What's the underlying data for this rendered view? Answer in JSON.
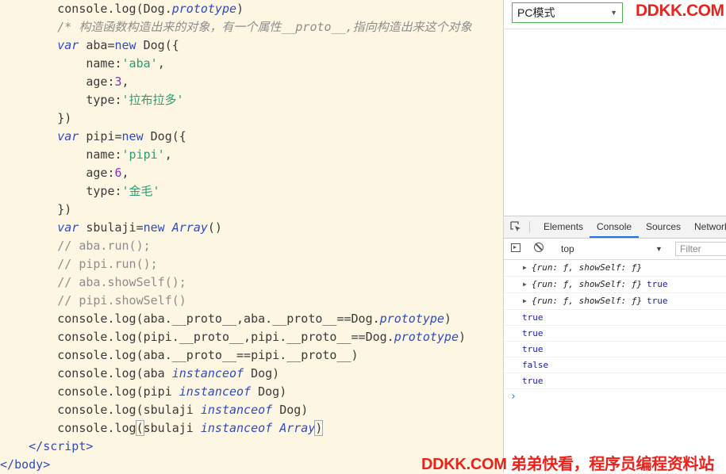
{
  "editor": {
    "lines": [
      {
        "indent": "        ",
        "tokens": [
          [
            "plain",
            "console.log(Dog."
          ],
          [
            "it",
            "prototype"
          ],
          [
            "plain",
            ")"
          ]
        ]
      },
      {
        "indent": "        ",
        "tokens": [
          [
            "cm",
            "/* 构造函数构造出来的对象，有一个属性__proto__,指向构造出来这个对象"
          ]
        ]
      },
      {
        "indent": "        ",
        "tokens": [
          [
            "it",
            "var"
          ],
          [
            "plain",
            " aba="
          ],
          [
            "kw",
            "new"
          ],
          [
            "plain",
            " Dog({"
          ]
        ]
      },
      {
        "indent": "            ",
        "tokens": [
          [
            "plain",
            "name:"
          ],
          [
            "str",
            "'aba'"
          ],
          [
            "plain",
            ","
          ]
        ]
      },
      {
        "indent": "            ",
        "tokens": [
          [
            "plain",
            "age:"
          ],
          [
            "num",
            "3"
          ],
          [
            "plain",
            ","
          ]
        ]
      },
      {
        "indent": "            ",
        "tokens": [
          [
            "plain",
            "type:"
          ],
          [
            "str",
            "'拉布拉多'"
          ]
        ]
      },
      {
        "indent": "        ",
        "tokens": [
          [
            "plain",
            "})"
          ]
        ]
      },
      {
        "indent": "        ",
        "tokens": [
          [
            "it",
            "var"
          ],
          [
            "plain",
            " pipi="
          ],
          [
            "kw",
            "new"
          ],
          [
            "plain",
            " Dog({"
          ]
        ]
      },
      {
        "indent": "            ",
        "tokens": [
          [
            "plain",
            "name:"
          ],
          [
            "str",
            "'pipi'"
          ],
          [
            "plain",
            ","
          ]
        ]
      },
      {
        "indent": "            ",
        "tokens": [
          [
            "plain",
            "age:"
          ],
          [
            "num",
            "6"
          ],
          [
            "plain",
            ","
          ]
        ]
      },
      {
        "indent": "            ",
        "tokens": [
          [
            "plain",
            "type:"
          ],
          [
            "str",
            "'金毛'"
          ]
        ]
      },
      {
        "indent": "        ",
        "tokens": [
          [
            "plain",
            "})"
          ]
        ]
      },
      {
        "indent": "        ",
        "tokens": [
          [
            "it",
            "var"
          ],
          [
            "plain",
            " sbulaji="
          ],
          [
            "kw",
            "new"
          ],
          [
            "plain",
            " "
          ],
          [
            "it",
            "Array"
          ],
          [
            "plain",
            "()"
          ]
        ]
      },
      {
        "indent": "        ",
        "tokens": [
          [
            "cm2",
            "// aba.run();"
          ]
        ]
      },
      {
        "indent": "        ",
        "tokens": [
          [
            "cm2",
            "// pipi.run();"
          ]
        ]
      },
      {
        "indent": "        ",
        "tokens": [
          [
            "cm2",
            "// aba.showSelf();"
          ]
        ]
      },
      {
        "indent": "        ",
        "tokens": [
          [
            "cm2",
            "// pipi.showSelf()"
          ]
        ]
      },
      {
        "indent": "        ",
        "tokens": [
          [
            "plain",
            "console.log(aba.__proto__,aba.__proto__==Dog."
          ],
          [
            "it",
            "prototype"
          ],
          [
            "plain",
            ")"
          ]
        ]
      },
      {
        "indent": "        ",
        "tokens": [
          [
            "plain",
            "console.log(pipi.__proto__,pipi.__proto__==Dog."
          ],
          [
            "it",
            "prototype"
          ],
          [
            "plain",
            ")"
          ]
        ]
      },
      {
        "indent": "        ",
        "tokens": [
          [
            "plain",
            "console.log(aba.__proto__==pipi.__proto__)"
          ]
        ]
      },
      {
        "indent": "        ",
        "tokens": [
          [
            "plain",
            "console.log(aba "
          ],
          [
            "it",
            "instanceof"
          ],
          [
            "plain",
            " Dog)"
          ]
        ]
      },
      {
        "indent": "        ",
        "tokens": [
          [
            "plain",
            "console.log(pipi "
          ],
          [
            "it",
            "instanceof"
          ],
          [
            "plain",
            " Dog)"
          ]
        ]
      },
      {
        "indent": "        ",
        "tokens": [
          [
            "plain",
            "console.log(sbulaji "
          ],
          [
            "it",
            "instanceof"
          ],
          [
            "plain",
            " Dog)"
          ]
        ]
      },
      {
        "indent": "        ",
        "tokens": [
          [
            "plain",
            "console.log"
          ],
          [
            "bracket",
            "("
          ],
          [
            "plain",
            "sbulaji "
          ],
          [
            "it",
            "instanceof"
          ],
          [
            "plain",
            " "
          ],
          [
            "it",
            "Array"
          ],
          [
            "bracket",
            ")"
          ]
        ]
      },
      {
        "indent": "    ",
        "tokens": [
          [
            "tag",
            "</"
          ],
          [
            "tag",
            "script"
          ],
          [
            "tag",
            ">"
          ]
        ]
      },
      {
        "indent": "",
        "tokens": [
          [
            "tag",
            "</"
          ],
          [
            "tag",
            "body"
          ],
          [
            "tag",
            ">"
          ]
        ]
      }
    ]
  },
  "toolbar": {
    "mode_value": "PC模式",
    "watermark_top": "DDKK.COM"
  },
  "devtools": {
    "tabs": [
      "Elements",
      "Console",
      "Sources",
      "Network"
    ],
    "active_tab": "Console",
    "context": "top",
    "filter_placeholder": "Filter"
  },
  "console": {
    "rows": [
      {
        "type": "object",
        "text": "{run: ƒ, showSelf: ƒ}",
        "bool": ""
      },
      {
        "type": "object",
        "text": "{run: ƒ, showSelf: ƒ}",
        "bool": "true"
      },
      {
        "type": "object",
        "text": "{run: ƒ, showSelf: ƒ}",
        "bool": "true"
      },
      {
        "type": "value",
        "text": "",
        "bool": "true"
      },
      {
        "type": "value",
        "text": "",
        "bool": "true"
      },
      {
        "type": "value",
        "text": "",
        "bool": "true"
      },
      {
        "type": "value",
        "text": "",
        "bool": "false"
      },
      {
        "type": "value",
        "text": "",
        "bool": "true"
      }
    ],
    "prompt": "›"
  },
  "watermark_bottom": "DDKK.COM 弟弟快看，程序员编程资料站"
}
